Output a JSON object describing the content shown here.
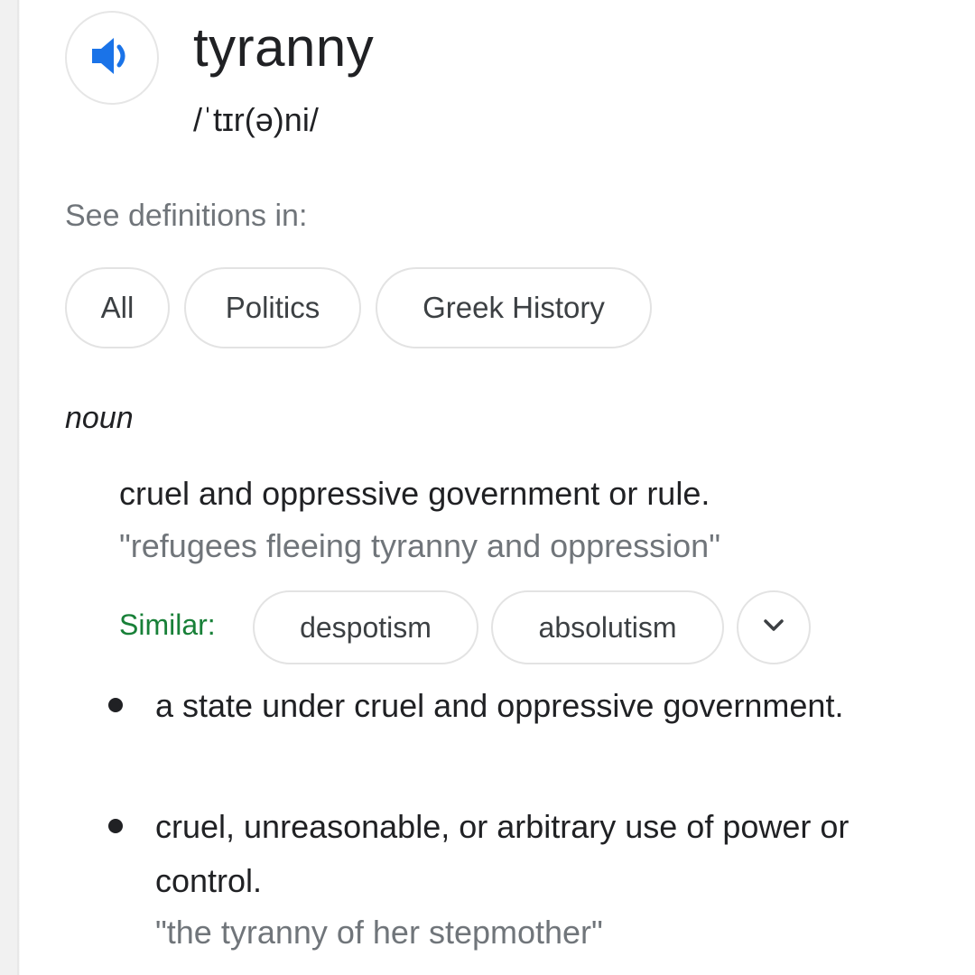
{
  "entry": {
    "word": "tyranny",
    "phonetic": "/ˈtɪr(ə)ni/",
    "speaker_icon": "speaker-volume-icon",
    "accent_color": "#1a73e8"
  },
  "see_definitions": {
    "label": "See definitions in:",
    "chips": [
      "All",
      "Politics",
      "Greek History"
    ]
  },
  "sense": {
    "part_of_speech": "noun",
    "definition": "cruel and oppressive government or rule.",
    "example": "\"refugees fleeing tyranny and oppression\"",
    "similar_label": "Similar:",
    "similar_color": "#188038",
    "synonyms": [
      "despotism",
      "absolutism"
    ],
    "expand_icon": "chevron-down-icon"
  },
  "sub_senses": [
    {
      "text": "a state under cruel and oppressive government."
    },
    {
      "text": "cruel, unreasonable, or arbitrary use of power or control.",
      "example": "\"the tyranny of her stepmother\""
    }
  ]
}
